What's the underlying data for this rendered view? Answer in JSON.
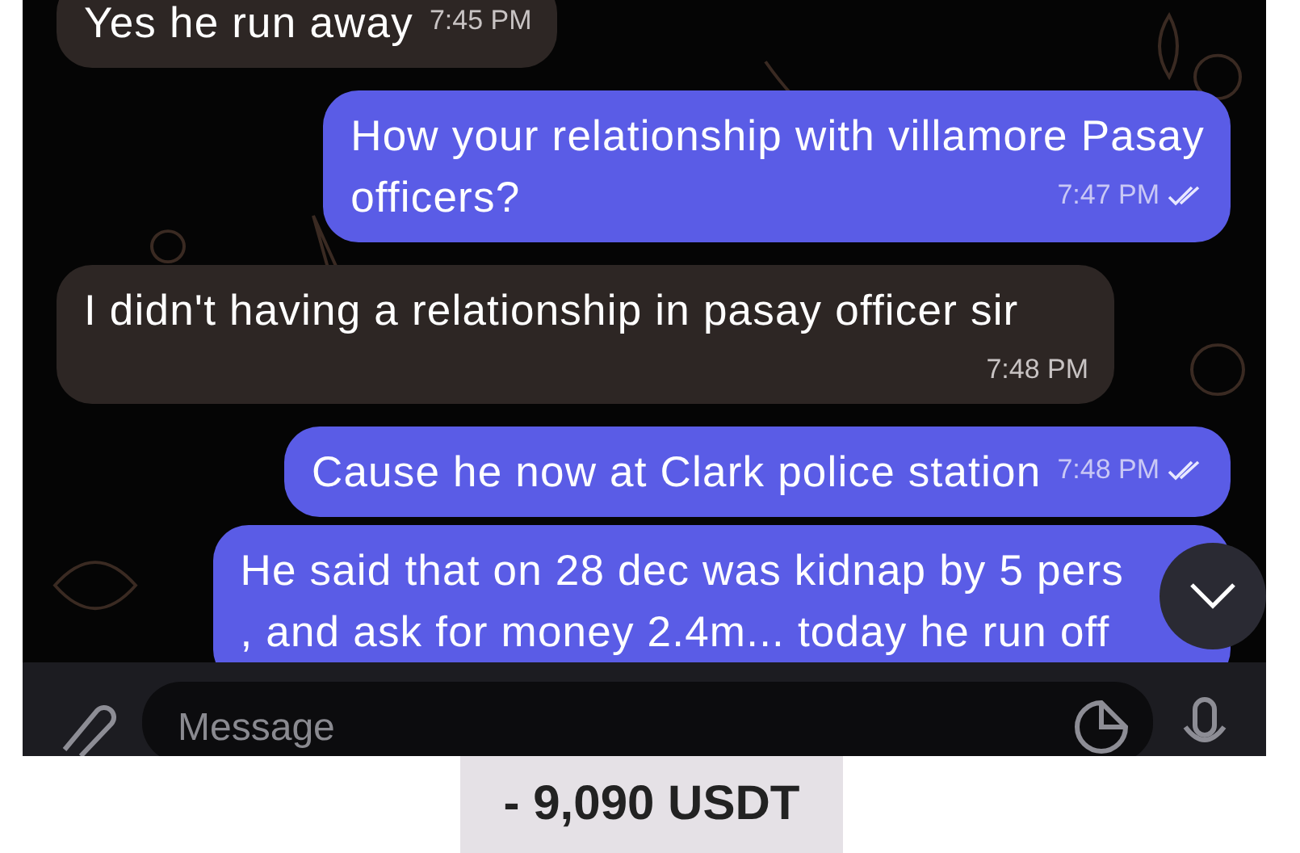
{
  "messages": [
    {
      "kind": "incoming",
      "text": "Yes he run away",
      "time": "7:45 PM"
    },
    {
      "kind": "outgoing",
      "text": "How your relationship with villamore Pasay\nofficers?",
      "time": "7:47 PM",
      "read": true
    },
    {
      "kind": "incoming",
      "text": "I didn't having a relationship in pasay officer sir",
      "time": "7:48 PM"
    },
    {
      "kind": "outgoing",
      "text": "Cause he now at Clark police station",
      "time": "7:48 PM",
      "read": true
    },
    {
      "kind": "outgoing",
      "text": "He said that on 28 dec was kidnap by 5 pers\n, and ask for money 2.4m... today he run off"
    }
  ],
  "composer": {
    "placeholder": "Message"
  },
  "amount": "- 9,090 USDT"
}
